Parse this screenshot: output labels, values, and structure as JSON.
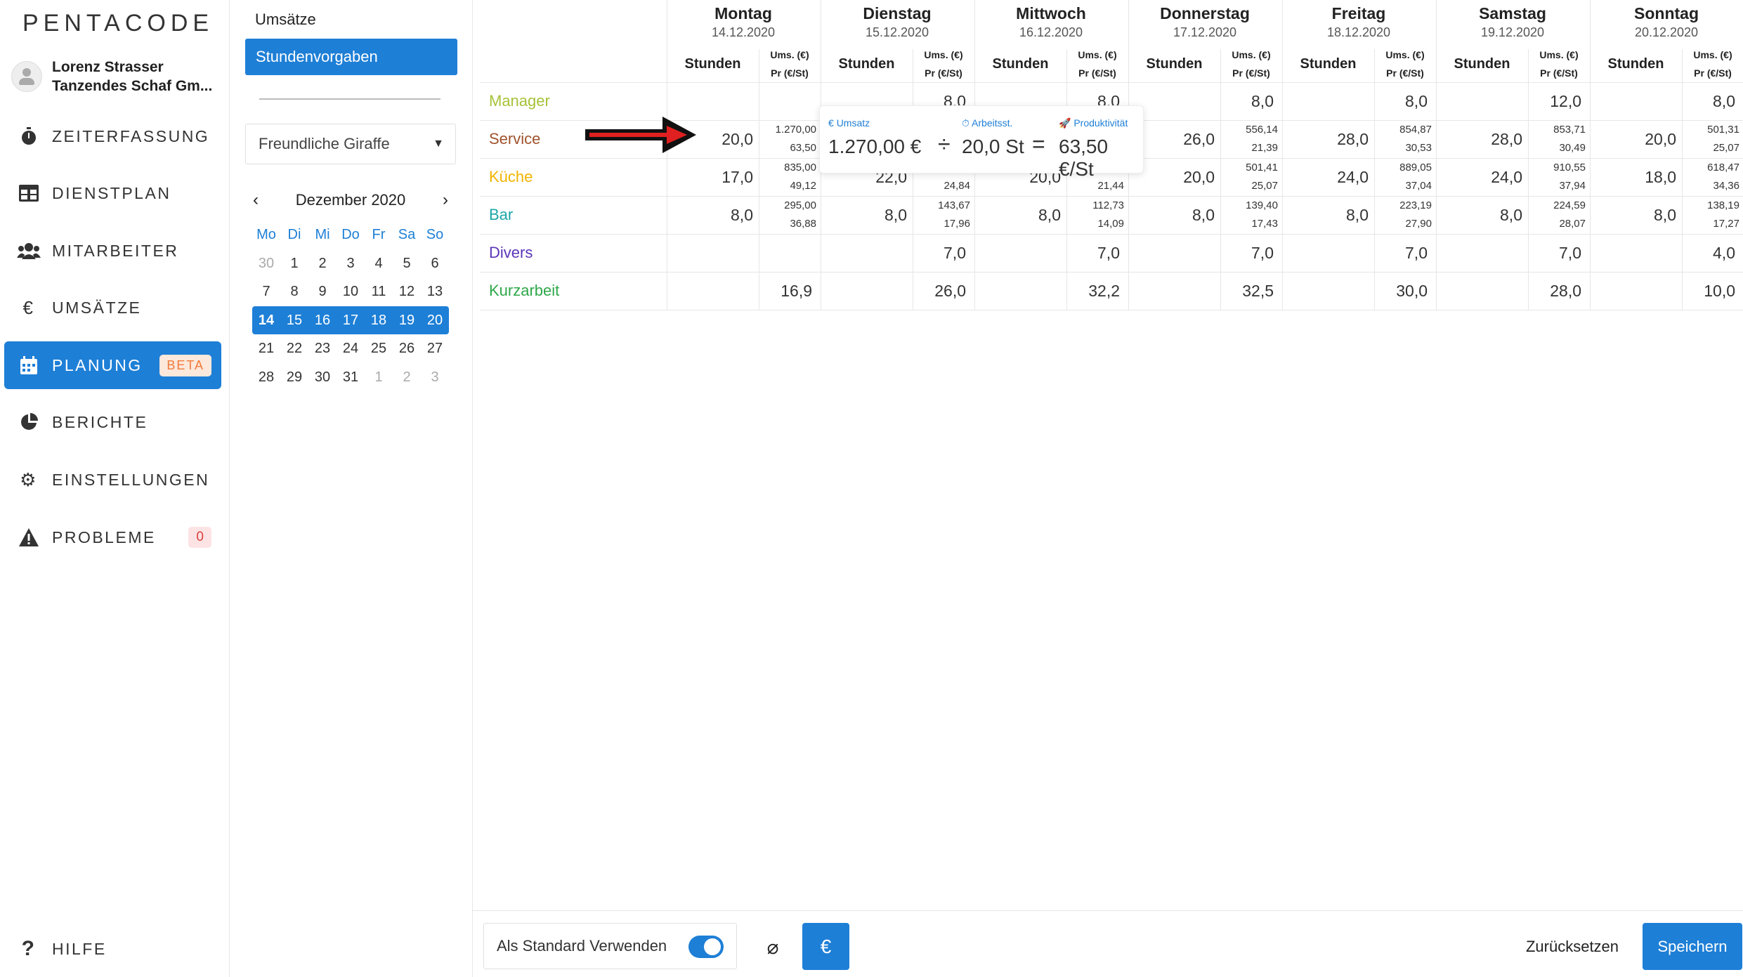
{
  "app": {
    "logo": "PENTACODE"
  },
  "user": {
    "name": "Lorenz Strasser",
    "company": "Tanzendes Schaf Gm..."
  },
  "nav": [
    {
      "label": "ZEITERFASSUNG",
      "icon": "stopwatch-icon"
    },
    {
      "label": "DIENSTPLAN",
      "icon": "table-icon"
    },
    {
      "label": "MITARBEITER",
      "icon": "users-icon"
    },
    {
      "label": "UMSÄTZE",
      "icon": "euro-icon"
    },
    {
      "label": "PLANUNG",
      "icon": "calendar-icon",
      "badge": "BETA",
      "active": true
    },
    {
      "label": "BERICHTE",
      "icon": "pie-chart-icon"
    },
    {
      "label": "EINSTELLUNGEN",
      "icon": "gear-icon"
    },
    {
      "label": "PROBLEME",
      "icon": "warning-icon",
      "count": "0"
    }
  ],
  "help": {
    "label": "HILFE",
    "icon": "question-icon"
  },
  "subnav": {
    "link": "Umsätze",
    "active": "Stundenvorgaben"
  },
  "location_select": {
    "value": "Freundliche Giraffe"
  },
  "calendar": {
    "month": "Dezember 2020",
    "prev": "‹",
    "next": "›",
    "weekdays": [
      "Mo",
      "Di",
      "Mi",
      "Do",
      "Fr",
      "Sa",
      "So"
    ],
    "weeks": [
      [
        "30",
        "1",
        "2",
        "3",
        "4",
        "5",
        "6"
      ],
      [
        "7",
        "8",
        "9",
        "10",
        "11",
        "12",
        "13"
      ],
      [
        "14",
        "15",
        "16",
        "17",
        "18",
        "19",
        "20"
      ],
      [
        "21",
        "22",
        "23",
        "24",
        "25",
        "26",
        "27"
      ],
      [
        "28",
        "29",
        "30",
        "31",
        "1",
        "2",
        "3"
      ]
    ],
    "selected_week": 2
  },
  "table": {
    "days": [
      {
        "name": "Montag",
        "date": "14.12.2020"
      },
      {
        "name": "Dienstag",
        "date": "15.12.2020"
      },
      {
        "name": "Mittwoch",
        "date": "16.12.2020"
      },
      {
        "name": "Donnerstag",
        "date": "17.12.2020"
      },
      {
        "name": "Freitag",
        "date": "18.12.2020"
      },
      {
        "name": "Samstag",
        "date": "19.12.2020"
      },
      {
        "name": "Sonntag",
        "date": "20.12.2020"
      }
    ],
    "col_hours": "Stunden",
    "col_ums": "Ums. (€)",
    "col_pr": "Pr (€/St)",
    "rows": [
      {
        "label": "Manager",
        "color": "#a6c23a",
        "cells": [
          {
            "h": ""
          },
          {
            "h": "8,0"
          },
          {
            "h": "8,0"
          },
          {
            "h": "8,0"
          },
          {
            "h": "8,0"
          },
          {
            "h": "12,0"
          },
          {
            "h": "8,0"
          }
        ]
      },
      {
        "label": "Service",
        "color": "#a0522d",
        "cells": [
          {
            "h": "20,0",
            "u": "1.270,00",
            "p": "63,50"
          },
          {
            "h": "",
            "u": "",
            "p": ""
          },
          {
            "h": "",
            "u": "",
            "p": ""
          },
          {
            "h": "26,0",
            "u": "556,14",
            "p": "21,39"
          },
          {
            "h": "28,0",
            "u": "854,87",
            "p": "30,53"
          },
          {
            "h": "28,0",
            "u": "853,71",
            "p": "30,49"
          },
          {
            "h": "20,0",
            "u": "501,31",
            "p": "25,07"
          }
        ]
      },
      {
        "label": "Küche",
        "color": "#f0b400",
        "cells": [
          {
            "h": "17,0",
            "u": "835,00",
            "p": "49,12"
          },
          {
            "h": "22,0",
            "u": "",
            "p": "24,84"
          },
          {
            "h": "20,0",
            "u": "",
            "p": "21,44"
          },
          {
            "h": "20,0",
            "u": "501,41",
            "p": "25,07"
          },
          {
            "h": "24,0",
            "u": "889,05",
            "p": "37,04"
          },
          {
            "h": "24,0",
            "u": "910,55",
            "p": "37,94"
          },
          {
            "h": "18,0",
            "u": "618,47",
            "p": "34,36"
          }
        ]
      },
      {
        "label": "Bar",
        "color": "#1aa6a6",
        "cells": [
          {
            "h": "8,0",
            "u": "295,00",
            "p": "36,88"
          },
          {
            "h": "8,0",
            "u": "143,67",
            "p": "17,96"
          },
          {
            "h": "8,0",
            "u": "112,73",
            "p": "14,09"
          },
          {
            "h": "8,0",
            "u": "139,40",
            "p": "17,43"
          },
          {
            "h": "8,0",
            "u": "223,19",
            "p": "27,90"
          },
          {
            "h": "8,0",
            "u": "224,59",
            "p": "28,07"
          },
          {
            "h": "8,0",
            "u": "138,19",
            "p": "17,27"
          }
        ]
      },
      {
        "label": "Divers",
        "color": "#5a35b8",
        "cells": [
          {
            "h": ""
          },
          {
            "h": "7,0"
          },
          {
            "h": "7,0"
          },
          {
            "h": "7,0"
          },
          {
            "h": "7,0"
          },
          {
            "h": "7,0"
          },
          {
            "h": "4,0"
          }
        ]
      },
      {
        "label": "Kurzarbeit",
        "color": "#2ea84a",
        "cells": [
          {
            "h": "16,9"
          },
          {
            "h": "26,0"
          },
          {
            "h": "32,2"
          },
          {
            "h": "32,5"
          },
          {
            "h": "30,0"
          },
          {
            "h": "28,0"
          },
          {
            "h": "10,0"
          }
        ]
      }
    ]
  },
  "tooltip": {
    "umsatz_label": "Umsatz",
    "umsatz_value": "1.270,00 €",
    "divide": "÷",
    "hours_label": "Arbeitsst.",
    "hours_value": "20,0 St",
    "equals": "=",
    "prod_label": "Produktivität",
    "prod_value": "63,50 €/St"
  },
  "footer": {
    "default_label": "Als Standard Verwenden",
    "default_on": true,
    "avg_symbol": "⌀",
    "euro_symbol": "€",
    "reset_label": "Zurücksetzen",
    "save_label": "Speichern"
  }
}
